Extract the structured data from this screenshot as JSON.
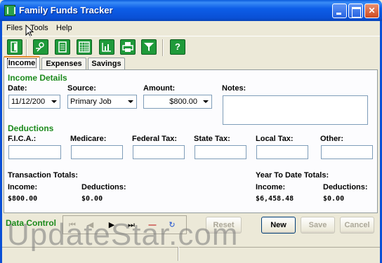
{
  "window": {
    "title": "Family Funds Tracker"
  },
  "menu": {
    "file": "Files",
    "tools": "Tools",
    "help": "Help"
  },
  "toolbar": {
    "buttons": [
      {
        "name": "exit-icon",
        "glyph": "▯"
      },
      {
        "name": "edit-account-icon",
        "glyph": "✎"
      },
      {
        "name": "calculator-icon",
        "glyph": "▦"
      },
      {
        "name": "spreadsheet-icon",
        "glyph": "▩"
      },
      {
        "name": "chart-icon",
        "glyph": "▥"
      },
      {
        "name": "print-icon",
        "glyph": "⎙"
      },
      {
        "name": "filter-icon",
        "glyph": "▼"
      },
      {
        "name": "help-icon",
        "glyph": "?"
      }
    ]
  },
  "tabs": {
    "income": "Income",
    "expenses": "Expenses",
    "savings": "Savings"
  },
  "income_details": {
    "heading": "Income Details",
    "date_label": "Date:",
    "date_value": "11/12/200",
    "source_label": "Source:",
    "source_value": "Primary Job",
    "amount_label": "Amount:",
    "amount_value": "$800.00",
    "notes_label": "Notes:"
  },
  "deductions": {
    "heading": "Deductions",
    "fica": "F.I.C.A.:",
    "medicare": "Medicare:",
    "federal": "Federal Tax:",
    "state": "State Tax:",
    "local": "Local Tax:",
    "other": "Other:"
  },
  "totals": {
    "transaction_heading": "Transaction Totals:",
    "ytd_heading": "Year To Date Totals:",
    "income_label": "Income:",
    "deductions_label": "Deductions:",
    "transaction_income": "$800.00",
    "transaction_deductions": "$0.00",
    "ytd_income": "$6,458.48",
    "ytd_deductions": "$0.00"
  },
  "data_control": {
    "label": "Data Control",
    "reset": "Reset",
    "new": "New",
    "save": "Save",
    "cancel": "Cancel"
  },
  "watermark": "UpdateStar.com",
  "colors": {
    "section_heading": "#1c8a1c",
    "titlebar": "#0a50d6",
    "toolbar_button": "#1f9a3a"
  }
}
